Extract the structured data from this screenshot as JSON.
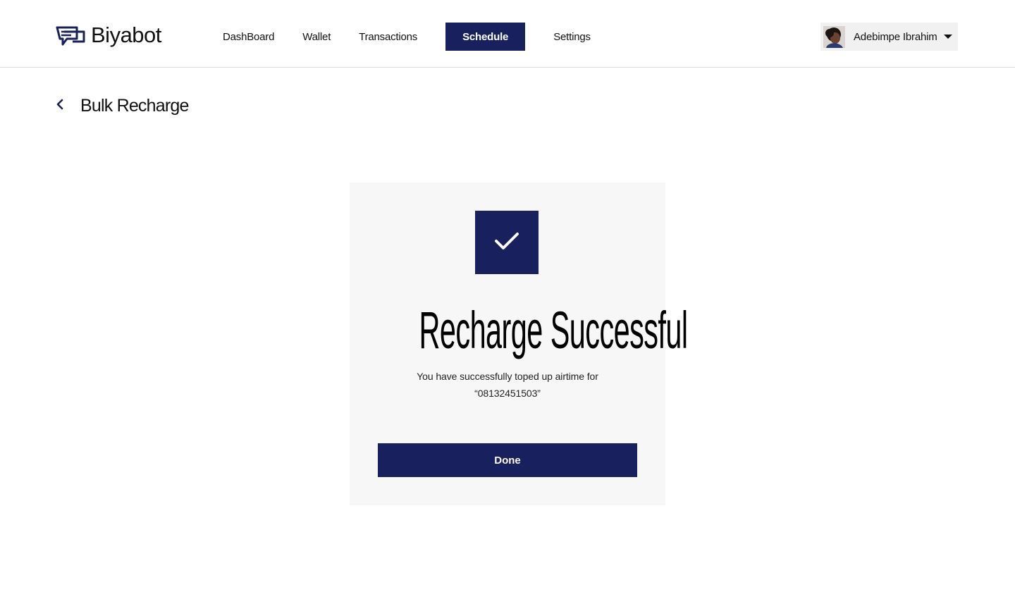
{
  "brand": {
    "name": "Biyabot",
    "logo_icon": "biyabot-logo-icon"
  },
  "nav": {
    "items": [
      {
        "label": "DashBoard",
        "active": false
      },
      {
        "label": "Wallet",
        "active": false
      },
      {
        "label": "Transactions",
        "active": false
      },
      {
        "label": "Schedule",
        "active": true
      },
      {
        "label": "Settings",
        "active": false
      }
    ]
  },
  "user": {
    "name": "Adebimpe Ibrahim",
    "avatar_icon": "user-avatar",
    "menu_icon": "caret-down-icon"
  },
  "page": {
    "title": "Bulk Recharge",
    "back_icon": "chevron-left-icon"
  },
  "modal": {
    "status_icon": "checkmark-icon",
    "title": "Recharge Successful",
    "message_line1": "You have successfully toped up airtime for",
    "message_line2": "“08132451503”",
    "button_label": "Done"
  },
  "colors": {
    "primary": "#18215d",
    "card_background": "#f7f7f7",
    "user_chip_background": "#f1f1f1",
    "divider": "#d9d9d9"
  }
}
